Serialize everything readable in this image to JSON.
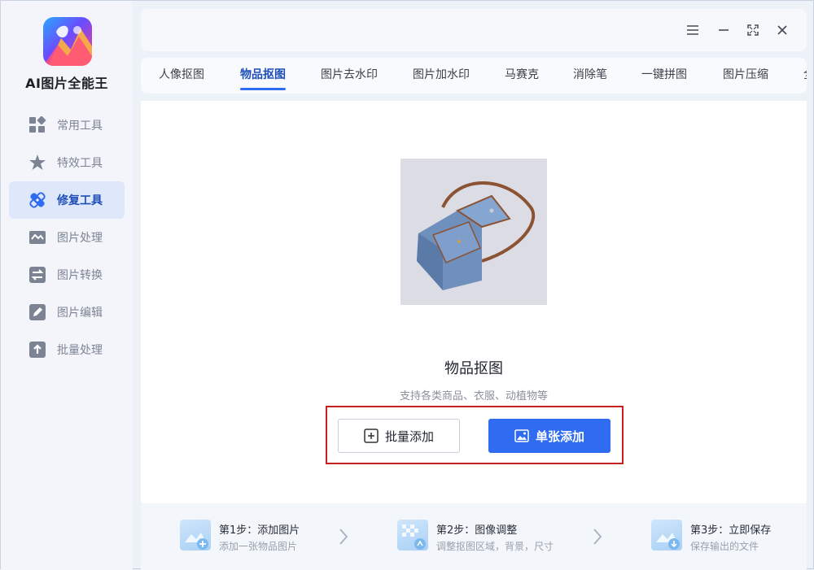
{
  "app": {
    "title": "AI图片全能王"
  },
  "sidebar": {
    "items": [
      {
        "label": "常用工具",
        "icon": "grid-icon",
        "active": false
      },
      {
        "label": "特效工具",
        "icon": "star-icon",
        "active": false
      },
      {
        "label": "修复工具",
        "icon": "bandage-icon",
        "active": true
      },
      {
        "label": "图片处理",
        "icon": "image-wave-icon",
        "active": false
      },
      {
        "label": "图片转换",
        "icon": "convert-icon",
        "active": false
      },
      {
        "label": "图片编辑",
        "icon": "edit-icon",
        "active": false
      },
      {
        "label": "批量处理",
        "icon": "upload-icon",
        "active": false
      }
    ]
  },
  "window_controls": [
    "menu-icon",
    "minimize-icon",
    "fullscreen-icon",
    "close-icon"
  ],
  "tabs": [
    {
      "label": "人像抠图",
      "active": false
    },
    {
      "label": "物品抠图",
      "active": true
    },
    {
      "label": "图片去水印",
      "active": false
    },
    {
      "label": "图片加水印",
      "active": false
    },
    {
      "label": "马赛克",
      "active": false
    },
    {
      "label": "消除笔",
      "active": false
    },
    {
      "label": "一键拼图",
      "active": false
    },
    {
      "label": "图片压缩",
      "active": false
    },
    {
      "label": "全",
      "active": false
    }
  ],
  "main": {
    "title": "物品抠图",
    "subtitle": "支持各类商品、衣服、动植物等",
    "batch_button": "批量添加",
    "single_button": "单张添加"
  },
  "steps": [
    {
      "title": "第1步：添加图片",
      "desc": "添加一张物品图片"
    },
    {
      "title": "第2步：图像调整",
      "desc": "调整抠图区域，背景，尺寸"
    },
    {
      "title": "第3步：立即保存",
      "desc": "保存输出的文件"
    }
  ],
  "colors": {
    "accent": "#2f6cf2",
    "active_nav_bg": "#dfe8fa",
    "highlight_border": "#c8201f"
  }
}
